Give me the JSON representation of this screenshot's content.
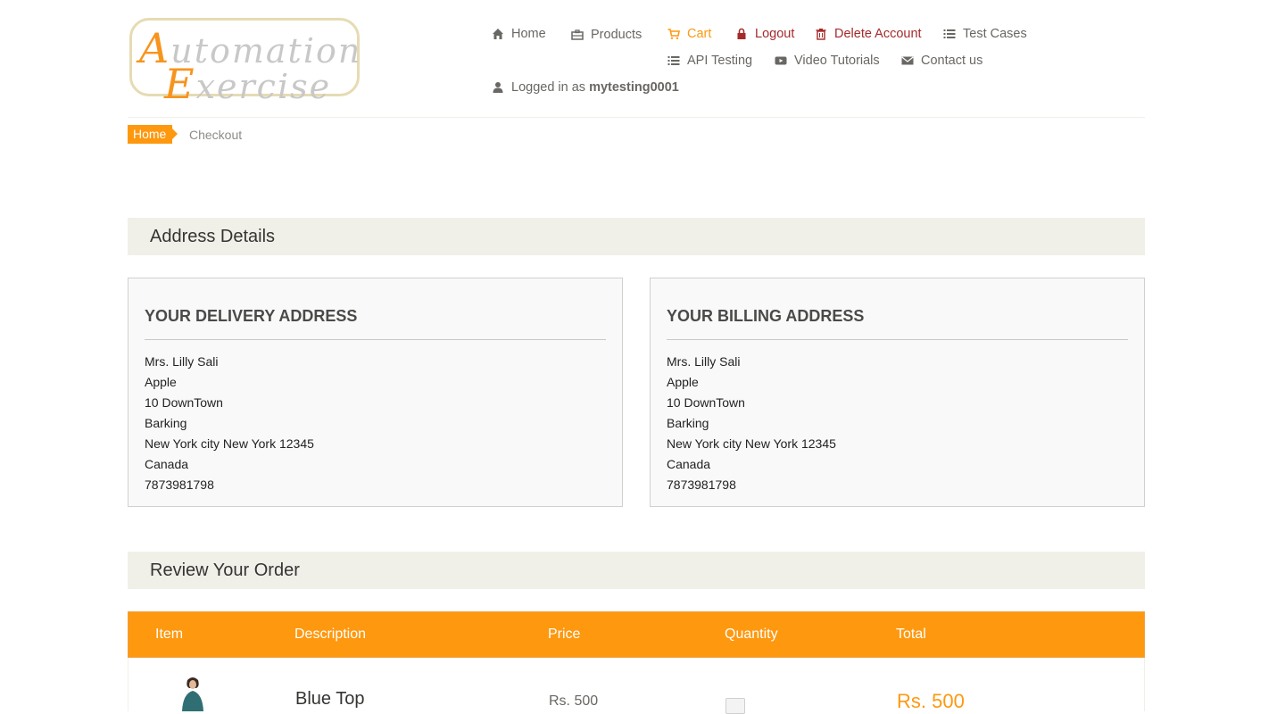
{
  "logo": {
    "line1_cap": "A",
    "line1_rest": "utomation",
    "line2_cap": "E",
    "line2_rest": "xercise"
  },
  "nav": {
    "items": [
      {
        "label": "Home",
        "icon": "home-icon"
      },
      {
        "label": "Products",
        "icon": "briefcase-icon"
      },
      {
        "label": "Cart",
        "icon": "cart-icon",
        "active": true
      },
      {
        "label": "Logout",
        "icon": "lock-icon"
      },
      {
        "label": "Delete Account",
        "icon": "trash-icon"
      },
      {
        "label": "Test Cases",
        "icon": "list-icon"
      },
      {
        "label": "API Testing",
        "icon": "list-icon"
      },
      {
        "label": "Video Tutorials",
        "icon": "youtube-play-icon"
      },
      {
        "label": "Contact us",
        "icon": "envelope-icon"
      }
    ],
    "logged_in_prefix": "Logged in as",
    "username": "mytesting0001"
  },
  "breadcrumb": {
    "home": "Home",
    "current": "Checkout"
  },
  "address_section": {
    "title": "Address Details"
  },
  "delivery": {
    "title": "YOUR DELIVERY ADDRESS",
    "lines": [
      "Mrs. Lilly Sali",
      "Apple",
      "10 DownTown",
      "Barking",
      "New York city New York 12345",
      "Canada",
      "7873981798"
    ]
  },
  "billing": {
    "title": "YOUR BILLING ADDRESS",
    "lines": [
      "Mrs. Lilly Sali",
      "Apple",
      "10 DownTown",
      "Barking",
      "New York city New York 12345",
      "Canada",
      "7873981798"
    ]
  },
  "review_section": {
    "title": "Review Your Order"
  },
  "table": {
    "headers": [
      "Item",
      "Description",
      "Price",
      "Quantity",
      "Total"
    ],
    "rows": [
      {
        "name": "Blue Top",
        "price": "Rs. 500",
        "total": "Rs. 500"
      }
    ]
  },
  "colors": {
    "accent": "#fe980f",
    "danger": "#a52a2a",
    "section_bg": "#f0f0e9"
  }
}
